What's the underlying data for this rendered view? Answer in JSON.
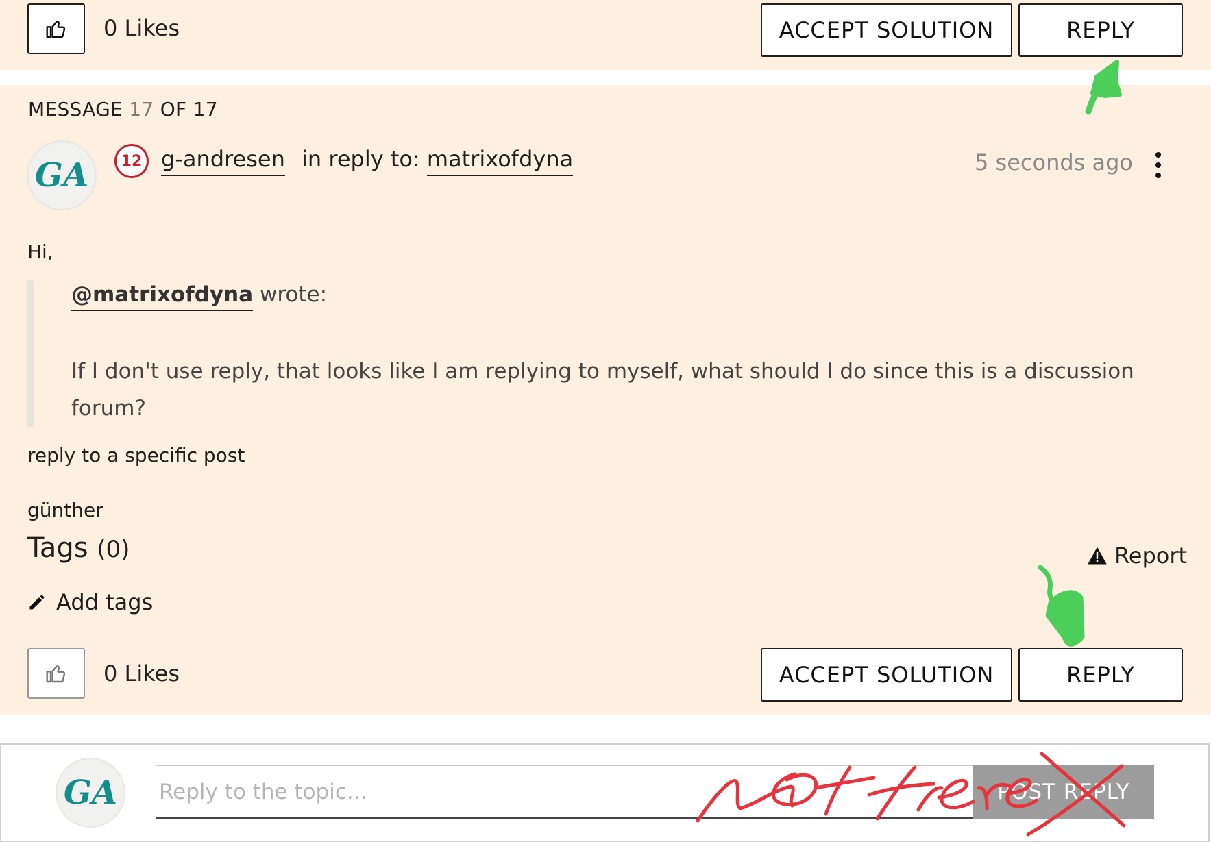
{
  "top_bar": {
    "likes_label": "0 Likes",
    "accept_solution_label": "ACCEPT SOLUTION",
    "reply_label": "REPLY"
  },
  "message": {
    "counter_prefix": "MESSAGE",
    "counter_index": "17",
    "counter_suffix": "OF 17",
    "author": "g-andresen",
    "rank_badge": "12",
    "in_reply_to_label": "in reply to:",
    "in_reply_to_user": "matrixofdyna",
    "timestamp": "5 seconds ago",
    "greeting": "Hi,",
    "quote": {
      "mention": "@matrixofdyna",
      "wrote_label": "wrote:",
      "text": "If I don't use reply, that looks like I am replying to myself, what should I do since this is a discussion forum?"
    },
    "body_line": "reply to a specific post",
    "signature": "günther"
  },
  "tags": {
    "title": "Tags",
    "count": "(0)",
    "add_label": "Add tags"
  },
  "report_label": "Report",
  "bottom_bar": {
    "likes_label": "0 Likes",
    "accept_solution_label": "ACCEPT SOLUTION",
    "reply_label": "REPLY"
  },
  "composer": {
    "placeholder": "Reply to the topic...",
    "value": "",
    "post_reply_label": "POST REPLY"
  },
  "avatar_initials": "GA",
  "annotation": {
    "text": "not here",
    "color": "#e8323c",
    "arrow_color": "#4ccf5a"
  },
  "colors": {
    "panel_bg": "#fdf0e0",
    "avatar_teal": "#138e8a",
    "badge_red": "#c8202a"
  }
}
